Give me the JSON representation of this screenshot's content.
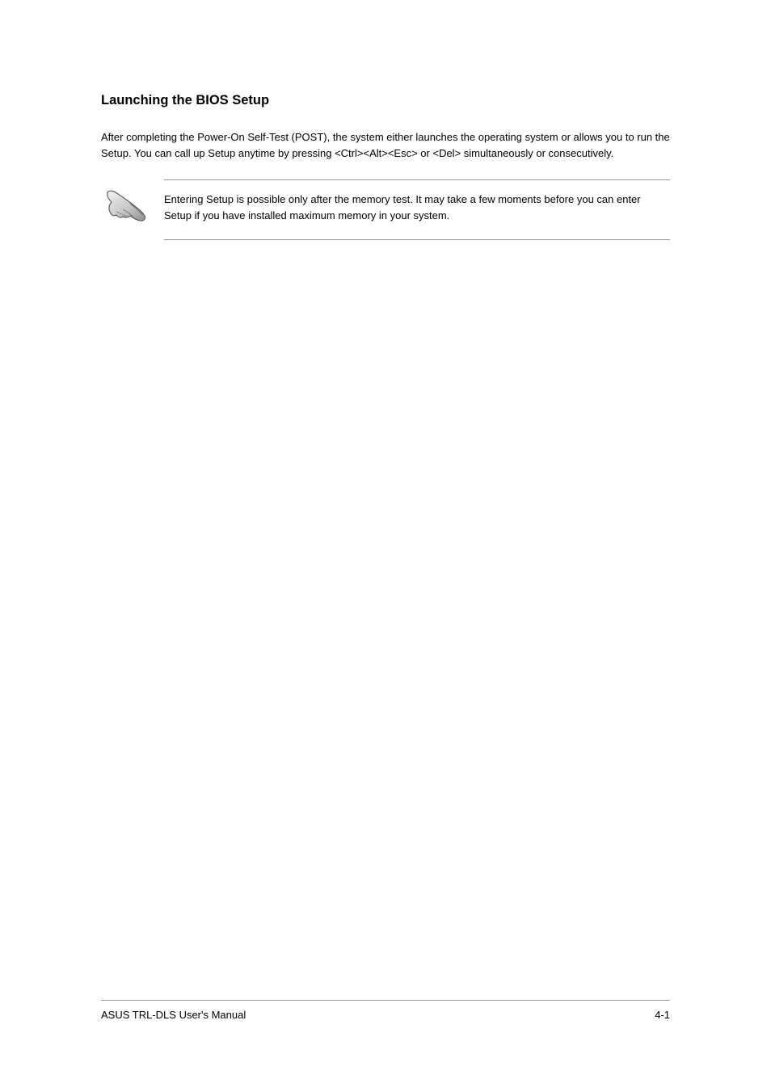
{
  "heading": "Launching the BIOS Setup",
  "paragraph1": "After completing the Power-On Self-Test (POST), the system either launches the operating system or allows you to run the Setup. You can call up Setup anytime by pressing <Ctrl><Alt><Esc> or <Del> simultaneously or consecutively.",
  "note": "Entering Setup is possible only after the memory test. It may take a few moments before you can enter Setup if you have installed maximum memory in your system.",
  "footer": {
    "left": "ASUS TRL-DLS User's Manual",
    "right": "4-1"
  }
}
